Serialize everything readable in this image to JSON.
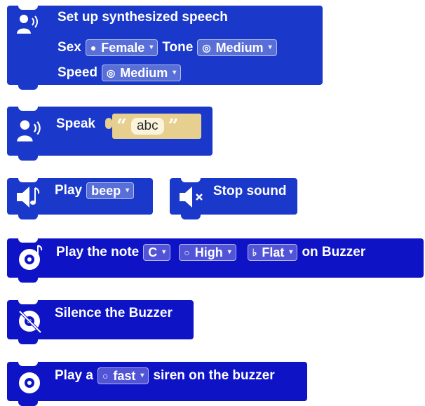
{
  "blocks": {
    "setup": {
      "title": "Set up synthesized speech",
      "sex_label": "Sex",
      "sex_value": "Female",
      "sex_glyph": "●",
      "tone_label": "Tone",
      "tone_value": "Medium",
      "tone_glyph": "◎",
      "speed_label": "Speed",
      "speed_value": "Medium",
      "speed_glyph": "◎",
      "icon": "speaking-head-icon"
    },
    "speak": {
      "label": "Speak",
      "text_value": "abc",
      "open_quote": "“",
      "close_quote": "”",
      "icon": "speaking-head-icon"
    },
    "play": {
      "label": "Play",
      "sound_value": "beep",
      "icon": "speaker-music-icon"
    },
    "stop": {
      "label": "Stop sound",
      "icon": "speaker-mute-icon"
    },
    "play_note": {
      "label": "Play the note",
      "note_value": "C",
      "octave_value": "High",
      "octave_glyph": "○",
      "accidental_value": "Flat",
      "accidental_glyph": "♭",
      "suffix": "on Buzzer",
      "icon": "buzzer-note-icon"
    },
    "silence": {
      "label": "Silence the Buzzer",
      "icon": "buzzer-off-icon"
    },
    "siren": {
      "label": "Play a",
      "speed_value": "fast",
      "speed_glyph": "○",
      "suffix": "siren on the buzzer",
      "icon": "buzzer-icon"
    }
  },
  "dropdown_arrow": "▾",
  "colors": {
    "block_blue": "#1a38c9",
    "block_dark_blue": "#0e13c6",
    "text_block": "#e7cf8f"
  }
}
